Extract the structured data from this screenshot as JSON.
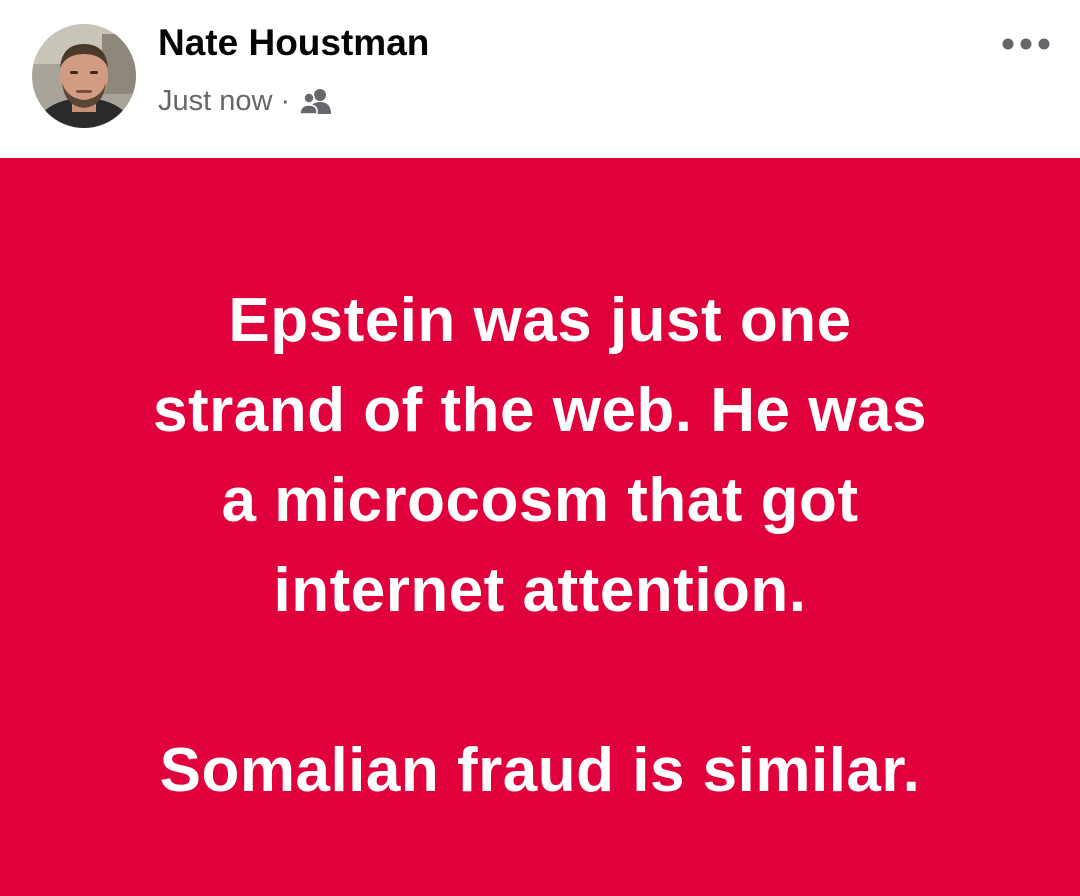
{
  "post": {
    "author": {
      "name": "Nate Houstman"
    },
    "meta": {
      "timestamp": "Just now",
      "separator": "·",
      "audience_icon": "friends-icon"
    },
    "more_icon": "more-dots-icon",
    "background_color": "#e0003c",
    "text_lines": [
      "Epstein was just one",
      "strand of the web. He was",
      "a microcosm that got",
      "internet attention."
    ],
    "closing_line": "Somalian fraud is similar."
  }
}
